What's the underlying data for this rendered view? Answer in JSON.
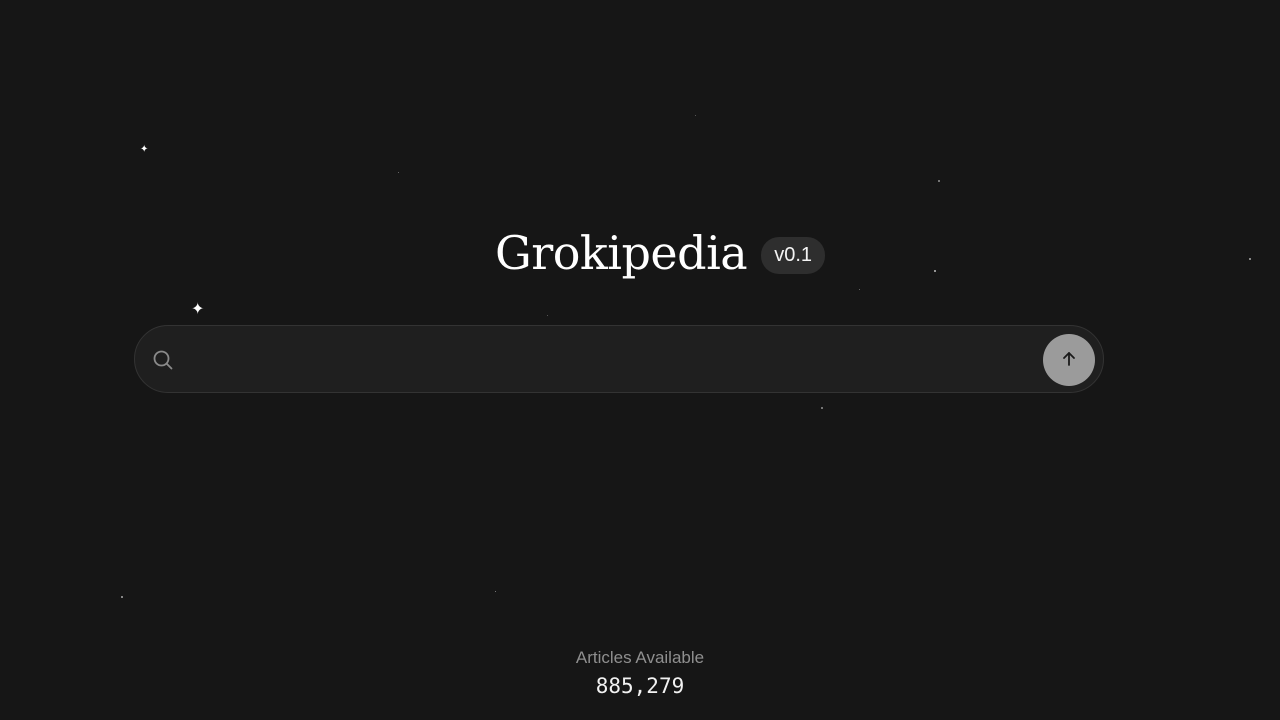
{
  "app": {
    "title": "Grokipedia",
    "version": "v0.1"
  },
  "search": {
    "value": "",
    "placeholder": "",
    "icon": "search-icon",
    "submit_icon": "arrow-up-icon"
  },
  "stats": {
    "label": "Articles Available",
    "count": "885,279"
  },
  "colors": {
    "background": "#161616",
    "search_bg": "#1f1f1f",
    "submit_bg": "#9b9b9b",
    "version_bg": "#2e2e2e"
  }
}
